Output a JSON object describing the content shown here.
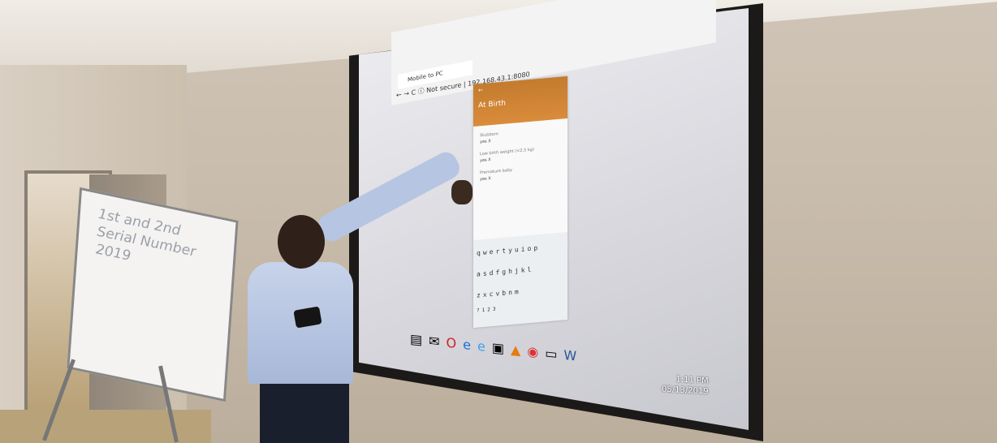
{
  "flipchart": {
    "line1": "1st and 2nd",
    "line2": "Serial Number",
    "line3": "2019"
  },
  "browser": {
    "tab_title": "Mobile to PC",
    "url_security": "Not secure",
    "url": "192.168.43.1:8080"
  },
  "phone_app": {
    "title": "At Birth",
    "fields": [
      {
        "label": "Stubborn",
        "options": "yes   X"
      },
      {
        "label": "Low birth weight (<2.5 kg)",
        "options": "yes   X"
      },
      {
        "label": "Premature baby",
        "options": "yes   X"
      }
    ],
    "keyboard_rows": [
      "qwertyuiop",
      "asdfghjkl",
      "zxcvbnm"
    ],
    "keyboard_mode": "?123"
  },
  "taskbar": {
    "time": "1:11 PM",
    "date": "05/13/2019"
  }
}
